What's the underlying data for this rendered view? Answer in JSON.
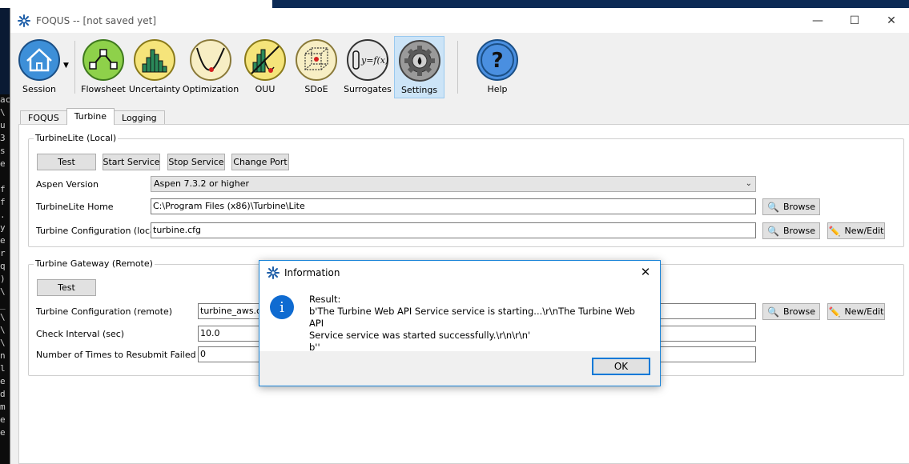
{
  "window": {
    "title": "FOQUS -- [not saved yet]",
    "minimize": "—",
    "maximize": "☐",
    "close": "✕"
  },
  "toolbar": {
    "items": [
      {
        "label": "Session",
        "icon": "house-icon"
      },
      {
        "label": "Flowsheet",
        "icon": "flowsheet-icon"
      },
      {
        "label": "Uncertainty",
        "icon": "histogram-icon"
      },
      {
        "label": "Optimization",
        "icon": "optimization-curve-icon"
      },
      {
        "label": "OUU",
        "icon": "ouu-icon"
      },
      {
        "label": "SDoE",
        "icon": "sdoe-cube-icon"
      },
      {
        "label": "Surrogates",
        "icon": "surrogate-function-icon"
      },
      {
        "label": "Settings",
        "icon": "gear-icon"
      },
      {
        "label": "Help",
        "icon": "question-icon"
      }
    ],
    "surrogate_formula": "y=f(x)",
    "help_glyph": "?"
  },
  "tabs": [
    {
      "label": "FOQUS"
    },
    {
      "label": "Turbine"
    },
    {
      "label": "Logging"
    }
  ],
  "turbinelite": {
    "group_title": "TurbineLite (Local)",
    "buttons": {
      "test": "Test",
      "start": "Start Service",
      "stop": "Stop Service",
      "change_port": "Change Port"
    },
    "aspen_label": "Aspen Version",
    "aspen_value": "Aspen 7.3.2 or higher",
    "home_label": "TurbineLite Home",
    "home_value": "C:\\Program Files (x86)\\Turbine\\Lite",
    "config_label": "Turbine Configuration (local)",
    "config_value": "turbine.cfg",
    "browse": "Browse",
    "new_edit": "New/Edit"
  },
  "gateway": {
    "group_title": "Turbine Gateway (Remote)",
    "test": "Test",
    "config_label": "Turbine Configuration (remote)",
    "config_value": "turbine_aws.cfg",
    "interval_label": "Check Interval (sec)",
    "interval_value": "10.0",
    "resubmit_label": "Number of Times to Resubmit Failed Jobs",
    "resubmit_value": "0",
    "browse": "Browse",
    "new_edit": "New/Edit"
  },
  "dialog": {
    "title": "Information",
    "close": "✕",
    "icon_glyph": "i",
    "line1": "Result:",
    "line2": "b'The Turbine Web API Service service is starting...\\r\\nThe Turbine Web API",
    "line3": "Service service was started successfully.\\r\\n\\r\\n'",
    "line4": "b''",
    "ok": "OK"
  },
  "terminal_chars": [
    "ac",
    "\\",
    "u",
    "3",
    "s",
    "e",
    "",
    "f",
    "f",
    ".",
    "y",
    "e",
    "r",
    "q",
    ")",
    "\\",
    "_",
    "\\",
    "\\",
    "\\",
    "n",
    "l",
    "e",
    "d",
    "m",
    "e",
    "e"
  ],
  "colors": {
    "accent": "#0078d7",
    "active_tab_bg": "#cce4f7",
    "info_icon": "#0f6bd1"
  }
}
